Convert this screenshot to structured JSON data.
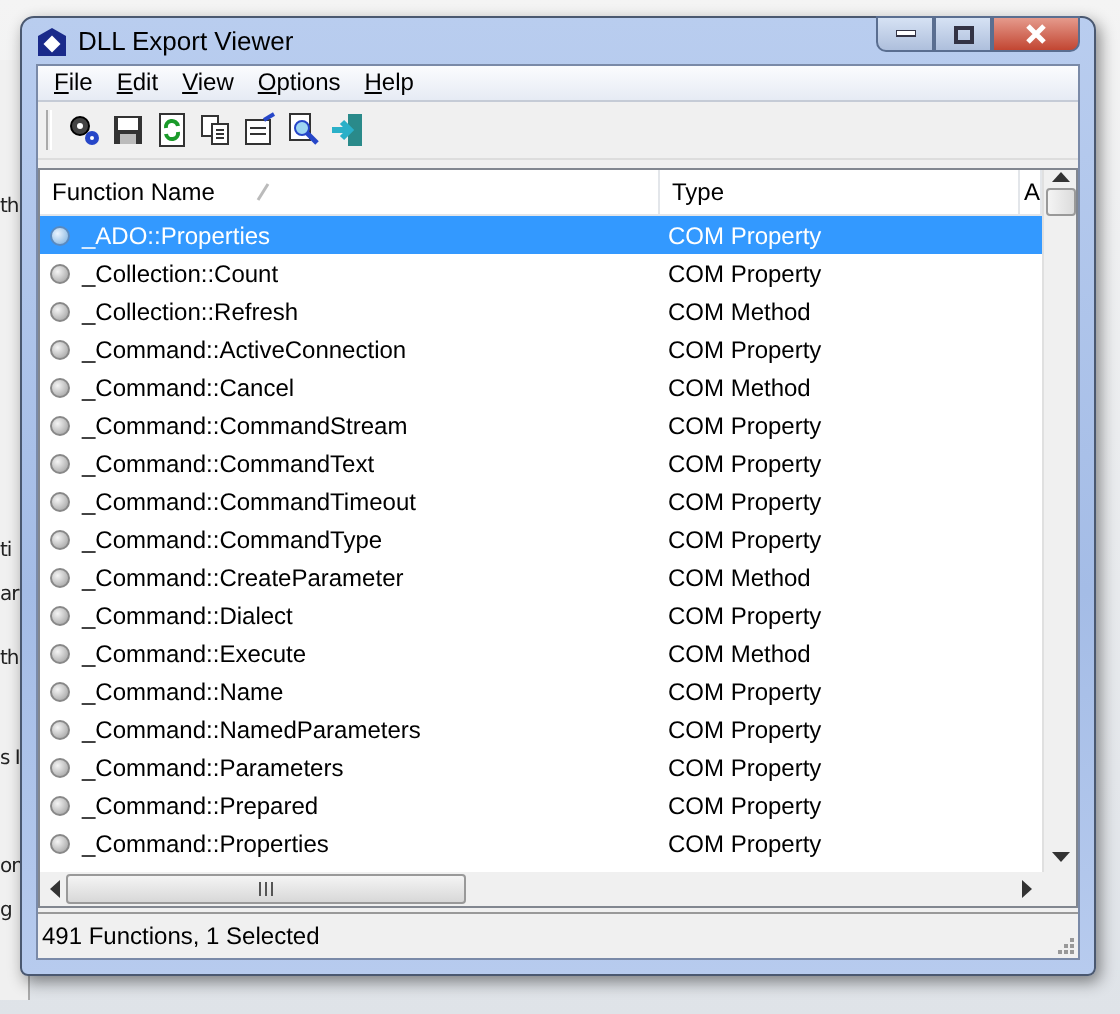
{
  "backdrop": {
    "fragments": [
      "th",
      "ti",
      "ar",
      "th",
      "s I",
      "on",
      "g"
    ]
  },
  "window": {
    "title": "DLL Export Viewer"
  },
  "menu": [
    {
      "label": "File"
    },
    {
      "label": "Edit"
    },
    {
      "label": "View"
    },
    {
      "label": "Options"
    },
    {
      "label": "Help"
    }
  ],
  "table": {
    "columns": [
      {
        "label": "Function Name",
        "sorted": true
      },
      {
        "label": "Type",
        "sorted": false
      },
      {
        "label": "A",
        "sorted": false
      }
    ],
    "rows": [
      {
        "name": "_ADO::Properties",
        "type": "COM Property",
        "selected": true
      },
      {
        "name": "_Collection::Count",
        "type": "COM Property",
        "selected": false
      },
      {
        "name": "_Collection::Refresh",
        "type": "COM Method",
        "selected": false
      },
      {
        "name": "_Command::ActiveConnection",
        "type": "COM Property",
        "selected": false
      },
      {
        "name": "_Command::Cancel",
        "type": "COM Method",
        "selected": false
      },
      {
        "name": "_Command::CommandStream",
        "type": "COM Property",
        "selected": false
      },
      {
        "name": "_Command::CommandText",
        "type": "COM Property",
        "selected": false
      },
      {
        "name": "_Command::CommandTimeout",
        "type": "COM Property",
        "selected": false
      },
      {
        "name": "_Command::CommandType",
        "type": "COM Property",
        "selected": false
      },
      {
        "name": "_Command::CreateParameter",
        "type": "COM Method",
        "selected": false
      },
      {
        "name": "_Command::Dialect",
        "type": "COM Property",
        "selected": false
      },
      {
        "name": "_Command::Execute",
        "type": "COM Method",
        "selected": false
      },
      {
        "name": "_Command::Name",
        "type": "COM Property",
        "selected": false
      },
      {
        "name": "_Command::NamedParameters",
        "type": "COM Property",
        "selected": false
      },
      {
        "name": "_Command::Parameters",
        "type": "COM Property",
        "selected": false
      },
      {
        "name": "_Command::Prepared",
        "type": "COM Property",
        "selected": false
      },
      {
        "name": "_Command::Properties",
        "type": "COM Property",
        "selected": false
      }
    ]
  },
  "status_bar": "491 Functions, 1 Selected"
}
